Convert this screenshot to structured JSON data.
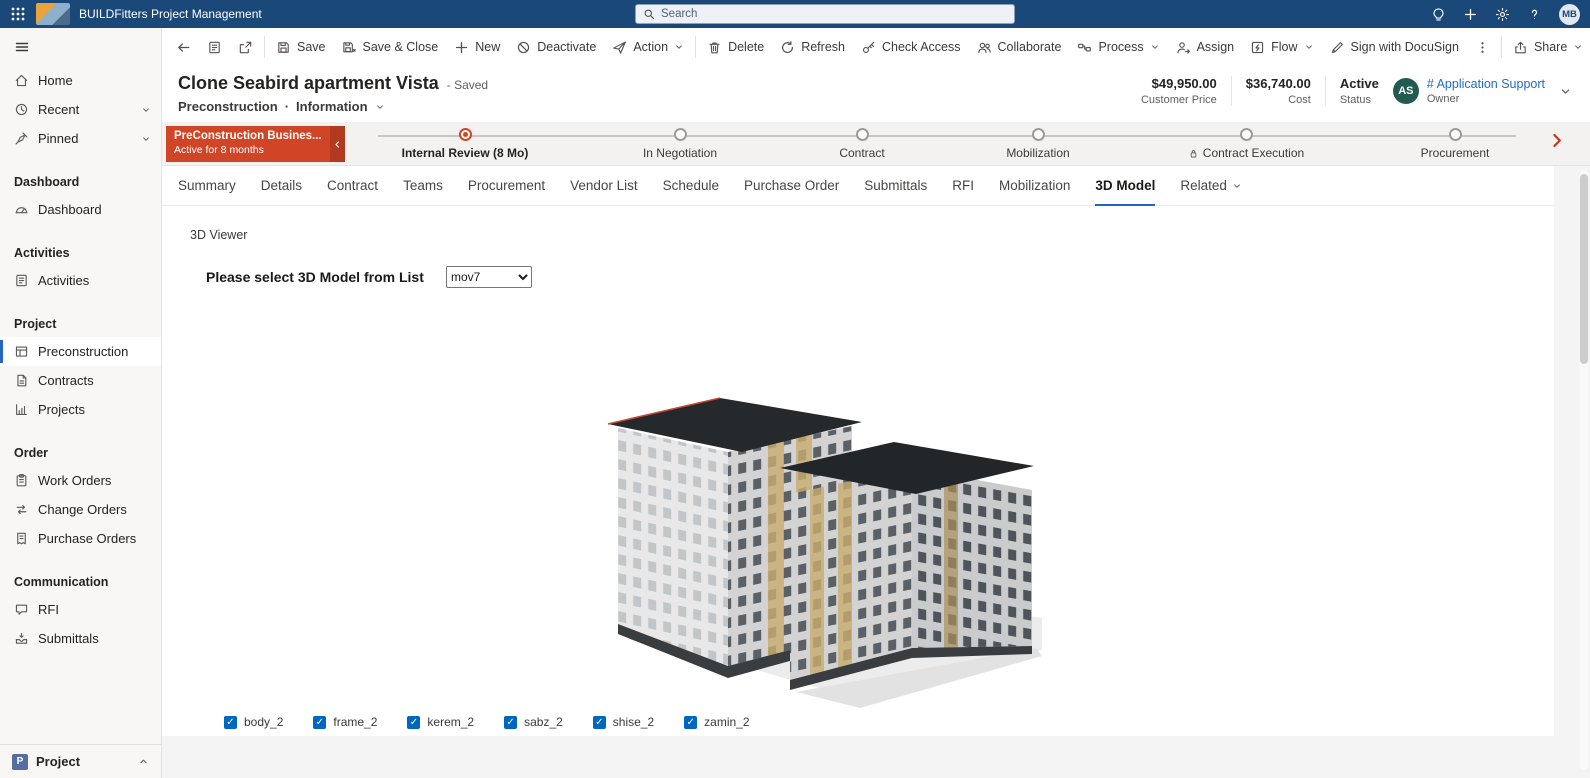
{
  "colors": {
    "topbar_navy": "#1a4878",
    "accent_blue": "#2266c2",
    "bpf_red": "#cf4526",
    "bpf_red_dark": "#b23a1f",
    "checkbox_blue": "#0067c0",
    "link_blue": "#1f6cc5",
    "owner_avatar_teal": "#235b52"
  },
  "icons": {
    "topbar": [
      "waffle-icon",
      "search-icon",
      "lightbulb-icon",
      "plus-icon",
      "gear-icon",
      "help-icon"
    ],
    "command_bar": [
      "back-icon",
      "form-icon",
      "popout-icon",
      "save-icon",
      "save-close-icon",
      "new-plus-icon",
      "deactivate-icon",
      "action-icon",
      "delete-icon",
      "refresh-icon",
      "check-access-icon",
      "collaborate-icon",
      "process-icon",
      "assign-icon",
      "flow-icon",
      "docusign-pen-icon",
      "overflow-icon",
      "share-icon"
    ],
    "sidebar": [
      "hamburger-icon",
      "home-icon",
      "clock-icon",
      "pin-icon",
      "gauge-icon",
      "activities-icon",
      "preconstruction-icon",
      "contracts-icon",
      "projects-icon",
      "work-orders-icon",
      "change-orders-icon",
      "purchase-orders-icon",
      "rfi-icon",
      "submittals-icon"
    ],
    "bpf": [
      "chevron-left-icon",
      "lock-icon",
      "chevron-right-icon"
    ]
  },
  "topbar": {
    "app_title": "BUILDFitters Project Management",
    "search_placeholder": "Search",
    "user_initials": "MB"
  },
  "command_bar": {
    "items": [
      {
        "label": "Save"
      },
      {
        "label": "Save & Close"
      },
      {
        "label": "New"
      },
      {
        "label": "Deactivate"
      },
      {
        "label": "Action",
        "chevron": true
      },
      {
        "label": "Delete"
      },
      {
        "label": "Refresh"
      },
      {
        "label": "Check Access"
      },
      {
        "label": "Collaborate"
      },
      {
        "label": "Process",
        "chevron": true
      },
      {
        "label": "Assign"
      },
      {
        "label": "Flow",
        "chevron": true
      },
      {
        "label": "Sign with DocuSign"
      }
    ],
    "share_label": "Share"
  },
  "sidebar": {
    "top_items": [
      {
        "label": "Home"
      },
      {
        "label": "Recent",
        "chevron": true
      },
      {
        "label": "Pinned",
        "chevron": true
      }
    ],
    "groups": [
      {
        "title": "Dashboard",
        "items": [
          {
            "label": "Dashboard"
          }
        ]
      },
      {
        "title": "Activities",
        "items": [
          {
            "label": "Activities"
          }
        ]
      },
      {
        "title": "Project",
        "items": [
          {
            "label": "Preconstruction",
            "selected": true
          },
          {
            "label": "Contracts"
          },
          {
            "label": "Projects"
          }
        ]
      },
      {
        "title": "Order",
        "items": [
          {
            "label": "Work Orders"
          },
          {
            "label": "Change Orders"
          },
          {
            "label": "Purchase Orders"
          }
        ]
      },
      {
        "title": "Communication",
        "items": [
          {
            "label": "RFI"
          },
          {
            "label": "Submittals"
          }
        ]
      }
    ],
    "footer": {
      "badge": "P",
      "label": "Project"
    }
  },
  "record_header": {
    "title": "Clone Seabird apartment Vista",
    "save_status": "- Saved",
    "breadcrumb_primary": "Preconstruction",
    "breadcrumb_separator": "·",
    "breadcrumb_secondary": "Information",
    "stats": [
      {
        "value": "$49,950.00",
        "label": "Customer Price"
      },
      {
        "value": "$36,740.00",
        "label": "Cost"
      },
      {
        "value": "Active",
        "label": "Status"
      }
    ],
    "owner": {
      "initials": "AS",
      "name": "# Application Support",
      "label": "Owner"
    }
  },
  "bpf": {
    "active_stage_title": "PreConstruction Busines...",
    "active_stage_subtitle": "Active for 8 months",
    "stages": [
      {
        "label": "Internal Review  (8 Mo)",
        "state": "current"
      },
      {
        "label": "In Negotiation",
        "state": "upcoming"
      },
      {
        "label": "Contract",
        "state": "upcoming"
      },
      {
        "label": "Mobilization",
        "state": "upcoming"
      },
      {
        "label": "Contract Execution",
        "state": "upcoming",
        "locked": true
      },
      {
        "label": "Procurement",
        "state": "upcoming"
      }
    ]
  },
  "tabs": {
    "items": [
      {
        "label": "Summary"
      },
      {
        "label": "Details"
      },
      {
        "label": "Contract"
      },
      {
        "label": "Teams"
      },
      {
        "label": "Procurement"
      },
      {
        "label": "Vendor List"
      },
      {
        "label": "Schedule"
      },
      {
        "label": "Purchase Order"
      },
      {
        "label": "Submittals"
      },
      {
        "label": "RFI"
      },
      {
        "label": "Mobilization"
      },
      {
        "label": "3D Model",
        "active": true
      },
      {
        "label": "Related",
        "chevron": true
      }
    ]
  },
  "viewer": {
    "section_title": "3D Viewer",
    "model_select_label": "Please select 3D Model from List",
    "model_selected": "mov7",
    "layers": [
      {
        "label": "body_2",
        "checked": true
      },
      {
        "label": "frame_2",
        "checked": true
      },
      {
        "label": "kerem_2",
        "checked": true
      },
      {
        "label": "sabz_2",
        "checked": true
      },
      {
        "label": "shise_2",
        "checked": true
      },
      {
        "label": "zamin_2",
        "checked": true
      }
    ]
  }
}
